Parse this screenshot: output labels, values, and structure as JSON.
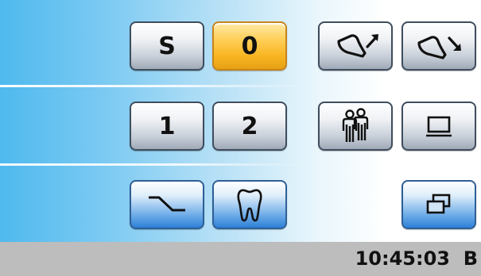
{
  "buttons": {
    "s_label": "S",
    "zero_label": "0",
    "one_label": "1",
    "two_label": "2"
  },
  "icons": {
    "chair_up": "chair-up-icon",
    "chair_down": "chair-down-icon",
    "patient": "patient-entry-icon",
    "monitor": "monitor-icon",
    "curve": "motion-curve-icon",
    "tooth": "tooth-icon",
    "windows": "window-switch-icon"
  },
  "status": {
    "time": "10:45:03",
    "mode": "B"
  },
  "colors": {
    "selected": "#f8b521",
    "accent_blue": "#2d80d8"
  }
}
